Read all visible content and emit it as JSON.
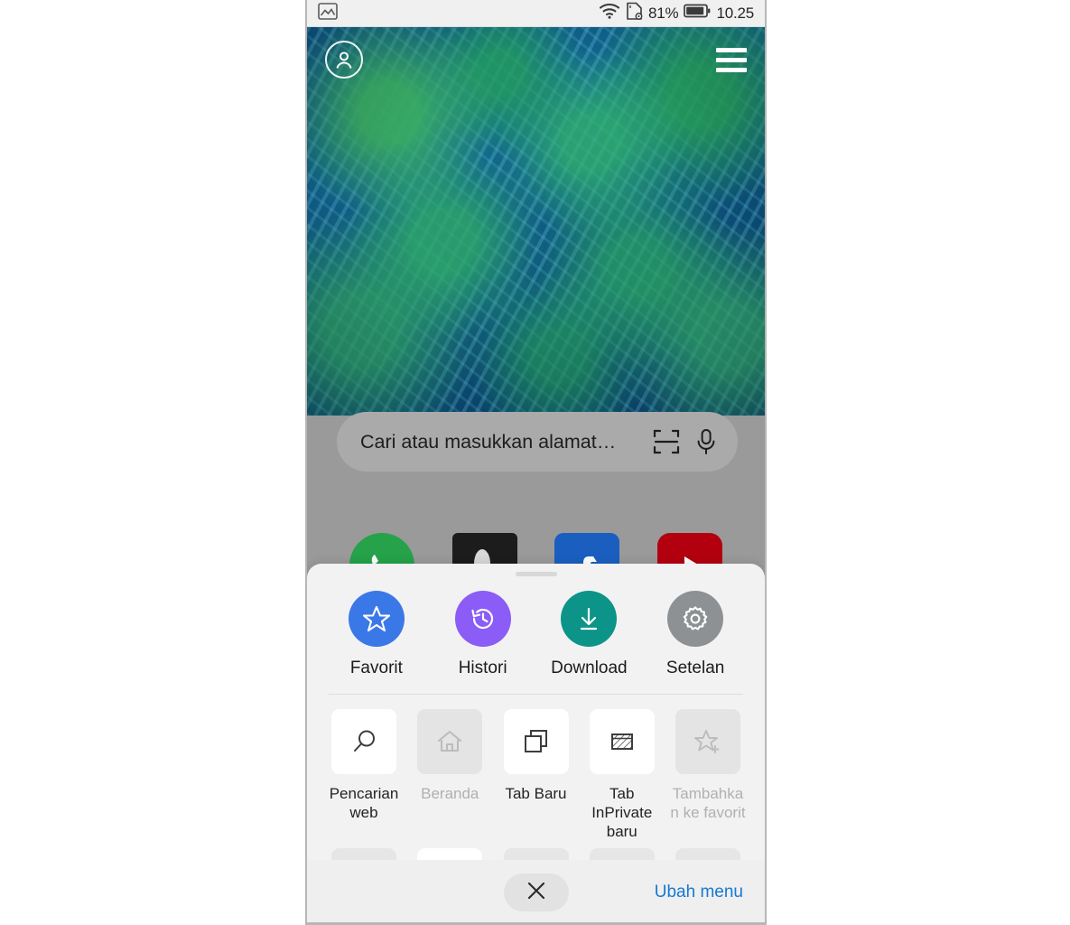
{
  "statusbar": {
    "left_icon": "image-icon",
    "wifi_icon": "wifi-icon",
    "sim_icon": "sim-card-icon",
    "battery_percent": "81%",
    "battery_icon": "battery-icon",
    "clock": "10.25"
  },
  "topnav": {
    "avatar_icon": "account-avatar-icon",
    "menu_icon": "hamburger-menu-icon"
  },
  "search": {
    "placeholder": "Cari atau masukkan alamat…",
    "qr_icon": "qr-scan-icon",
    "mic_icon": "microphone-icon"
  },
  "shortcuts": [
    {
      "name": "whatsapp",
      "color": "#25a24a"
    },
    {
      "name": "dark-app",
      "color": "#1c1c1c"
    },
    {
      "name": "facebook",
      "color": "#1a5fc0"
    },
    {
      "name": "youtube",
      "color": "#b3000f"
    }
  ],
  "sheet": {
    "quick_actions": [
      {
        "label": "Favorit",
        "icon": "star-outline-icon",
        "color": "#3b78e7"
      },
      {
        "label": "Histori",
        "icon": "history-clock-icon",
        "color": "#8b5cf6"
      },
      {
        "label": "Download",
        "icon": "download-arrow-icon",
        "color": "#0d9488"
      },
      {
        "label": "Setelan",
        "icon": "gear-icon",
        "color": "#8d9193"
      }
    ],
    "tiles": [
      {
        "label": "Pencarian web",
        "icon": "magnifier-icon",
        "disabled": false
      },
      {
        "label": "Beranda",
        "icon": "home-icon",
        "disabled": true
      },
      {
        "label": "Tab Baru",
        "icon": "new-tab-icon",
        "disabled": false
      },
      {
        "label": "Tab InPrivate baru",
        "icon": "inprivate-icon",
        "disabled": false
      },
      {
        "label": "Tambahkan ke favorit",
        "icon": "star-plus-icon",
        "disabled": true
      }
    ],
    "partial_tiles": [
      {
        "active": false
      },
      {
        "active": true
      },
      {
        "active": false
      },
      {
        "active": false
      },
      {
        "active": false
      }
    ],
    "close_icon": "close-x-icon",
    "edit_menu_label": "Ubah menu",
    "edit_menu_color": "#1579d2"
  },
  "annotation": {
    "arrow_icon": "pointer-arrow-icon",
    "arrow_color": "#f2702a"
  }
}
